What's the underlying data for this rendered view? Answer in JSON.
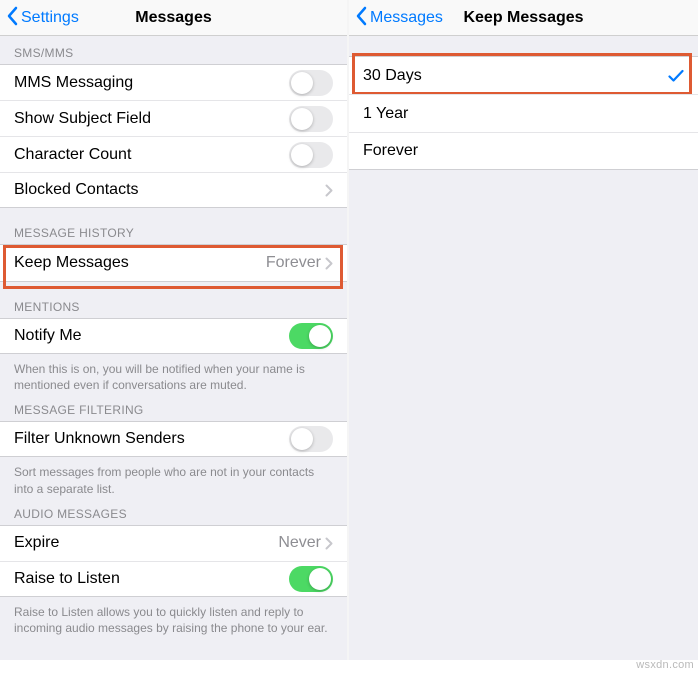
{
  "left": {
    "nav": {
      "back": "Settings",
      "title": "Messages"
    },
    "sections": {
      "sms": {
        "header": "SMS/MMS",
        "mms": "MMS Messaging",
        "subject": "Show Subject Field",
        "charcount": "Character Count",
        "blocked": "Blocked Contacts"
      },
      "history": {
        "header": "MESSAGE HISTORY",
        "keep": "Keep Messages",
        "keep_value": "Forever"
      },
      "mentions": {
        "header": "MENTIONS",
        "notify": "Notify Me",
        "footer": "When this is on, you will be notified when your name is mentioned even if conversations are muted."
      },
      "filtering": {
        "header": "MESSAGE FILTERING",
        "filter": "Filter Unknown Senders",
        "footer": "Sort messages from people who are not in your contacts into a separate list."
      },
      "audio": {
        "header": "AUDIO MESSAGES",
        "expire": "Expire",
        "expire_value": "Never",
        "raise": "Raise to Listen",
        "footer": "Raise to Listen allows you to quickly listen and reply to incoming audio messages by raising the phone to your ear."
      }
    }
  },
  "right": {
    "nav": {
      "back": "Messages",
      "title": "Keep Messages"
    },
    "options": {
      "opt30": "30 Days",
      "opt1y": "1 Year",
      "optforever": "Forever"
    }
  },
  "watermark": "wsxdn.com"
}
